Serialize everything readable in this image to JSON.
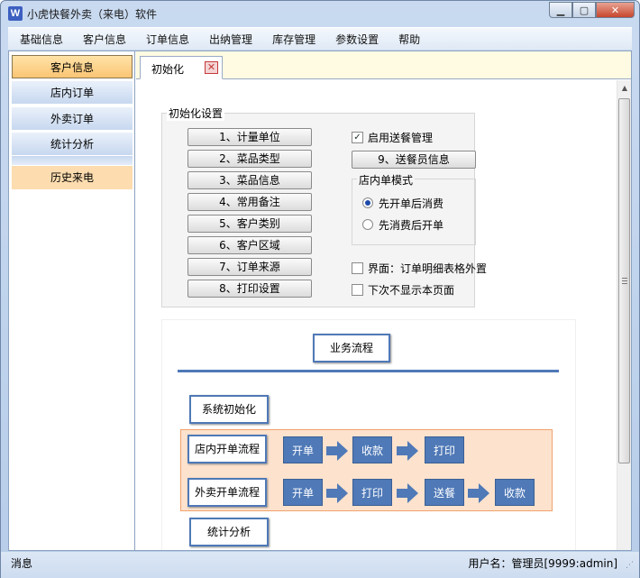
{
  "window": {
    "title": "小虎快餐外卖（来电）软件",
    "app_icon": "W",
    "buttons": {
      "minimize": "▁",
      "maximize": "▢",
      "close": "✕"
    }
  },
  "menu": [
    "基础信息",
    "客户信息",
    "订单信息",
    "出纳管理",
    "库存管理",
    "参数设置",
    "帮助"
  ],
  "sidebar": {
    "items": [
      {
        "label": "客户信息",
        "state": "active"
      },
      {
        "label": "店内订单",
        "state": "normal"
      },
      {
        "label": "外卖订单",
        "state": "normal"
      },
      {
        "label": "统计分析",
        "state": "normal"
      },
      {
        "label": "历史来电",
        "state": "highlight"
      }
    ]
  },
  "tabs": [
    {
      "label": "初始化",
      "close": "✕"
    }
  ],
  "init": {
    "group_title": "初始化设置",
    "buttons": [
      "1、计量单位",
      "2、菜品类型",
      "3、菜品信息",
      "4、常用备注",
      "5、客户类别",
      "6、客户区域",
      "7、订单来源",
      "8、打印设置"
    ],
    "delivery_checkbox": {
      "label": "启用送餐管理",
      "checked": true
    },
    "courier_button": "9、送餐员信息",
    "mode_group": {
      "title": "店内单模式",
      "options": [
        {
          "label": "先开单后消费",
          "selected": true
        },
        {
          "label": "先消费后开单",
          "selected": false
        }
      ]
    },
    "ui_checkbox": {
      "label": "界面：订单明细表格外置",
      "checked": false
    },
    "hide_checkbox": {
      "label": "下次不显示本页面",
      "checked": false
    }
  },
  "flow": {
    "title": "业务流程",
    "init_step": "系统初始化",
    "instore": {
      "label": "店内开单流程",
      "steps": [
        "开单",
        "收款",
        "打印"
      ]
    },
    "takeout": {
      "label": "外卖开单流程",
      "steps": [
        "开单",
        "打印",
        "送餐",
        "收款"
      ]
    },
    "stats_step": "统计分析"
  },
  "status": {
    "left": "消息",
    "right": "用户名：管理员[9999:admin]"
  },
  "colors": {
    "flow_blue": "#4f79b7",
    "band_fill": "#fde2cd",
    "band_border": "#efa36d",
    "sidebar_active": "#fbc574",
    "tab_strip": "#fffbe2"
  }
}
